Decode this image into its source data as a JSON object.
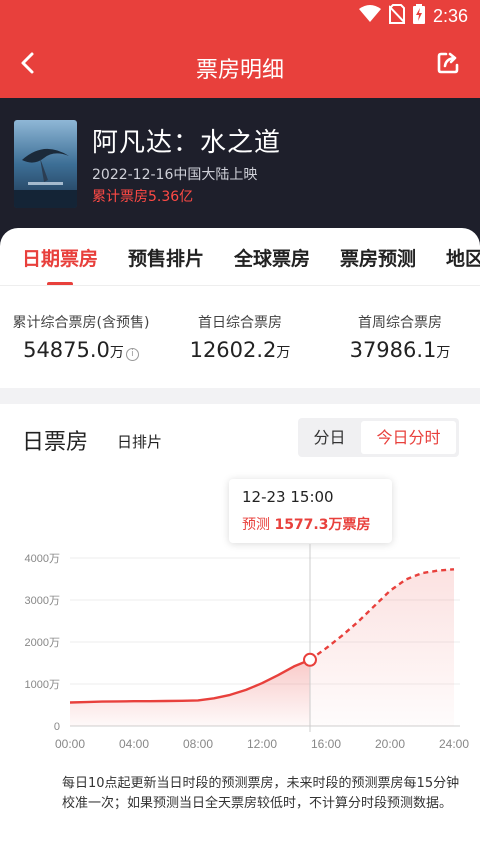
{
  "status_bar": {
    "time": "2:36",
    "icons": [
      "wifi-icon",
      "no-sim-icon",
      "battery-charging-icon"
    ]
  },
  "app_bar": {
    "title": "票房明细",
    "back_icon": "chevron-left-icon",
    "share_icon": "share-icon"
  },
  "movie": {
    "title": "阿凡达：水之道",
    "release": "2022-12-16中国大陆上映",
    "box_office_label": "累计票房",
    "box_office_value": "5.36亿"
  },
  "tabs": [
    {
      "label": "日期票房",
      "active": true
    },
    {
      "label": "预售排片",
      "active": false
    },
    {
      "label": "全球票房",
      "active": false
    },
    {
      "label": "票房预测",
      "active": false
    },
    {
      "label": "地区",
      "active": false
    }
  ],
  "stats": [
    {
      "label": "累计综合票房(含预售)",
      "value": "54875.0",
      "unit": "万",
      "info": true
    },
    {
      "label": "首日综合票房",
      "value": "12602.2",
      "unit": "万",
      "info": false
    },
    {
      "label": "首周综合票房",
      "value": "37986.1",
      "unit": "万",
      "info": false
    }
  ],
  "daily": {
    "title": "日票房",
    "subtitle": "日排片",
    "segments": [
      {
        "label": "分日",
        "active": false
      },
      {
        "label": "今日分时",
        "active": true
      }
    ],
    "tooltip": {
      "time": "12-23 15:00",
      "label": "预测",
      "value": "1577.3万票房"
    },
    "note": "每日10点起更新当日时段的预测票房，未来时段的预测票房每15分钟校准一次；如果预测当日全天票房较低时，不计算分时段预测数据。"
  },
  "colors": {
    "brand": "#e8403c",
    "header_dark": "#1e1f2b",
    "forecast": "#e8403c"
  },
  "chart_data": {
    "type": "area",
    "x_ticks": [
      "00:00",
      "04:00",
      "08:00",
      "12:00",
      "16:00",
      "20:00",
      "24:00"
    ],
    "y_ticks": [
      "0",
      "1000万",
      "2000万",
      "3000万",
      "4000万"
    ],
    "ylim": [
      0,
      4000
    ],
    "xlim": [
      0,
      24
    ],
    "series": [
      {
        "style": "solid",
        "x": [
          0,
          1,
          2,
          3,
          4,
          5,
          6,
          7,
          8,
          9,
          10,
          11,
          12,
          13,
          14,
          15
        ],
        "y": [
          560,
          570,
          580,
          585,
          590,
          590,
          595,
          600,
          610,
          660,
          740,
          860,
          1020,
          1210,
          1420,
          1577
        ]
      },
      {
        "style": "dashed",
        "x": [
          15,
          16,
          17,
          18,
          19,
          20,
          21,
          22,
          23,
          24
        ],
        "y": [
          1577,
          1850,
          2150,
          2480,
          2850,
          3220,
          3490,
          3640,
          3700,
          3730
        ]
      }
    ],
    "marker": {
      "x": 15,
      "y": 1577
    }
  }
}
